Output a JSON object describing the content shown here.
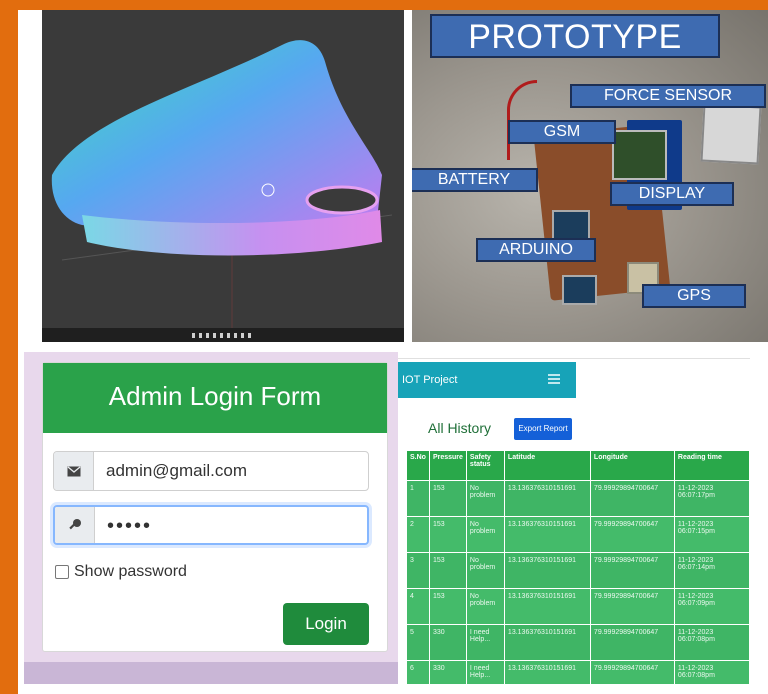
{
  "prototype": {
    "title": "PROTOTYPE",
    "labels": {
      "force_sensor": "FORCE SENSOR",
      "gsm": "GSM",
      "battery": "BATTERY",
      "display": "DISPLAY",
      "arduino": "ARDUINO",
      "gps": "GPS"
    }
  },
  "login": {
    "title": "Admin Login Form",
    "email_value": "admin@gmail.com",
    "password_value": "•••••",
    "show_password_label": "Show password",
    "login_button": "Login",
    "icons": {
      "email": "envelope-icon",
      "password": "key-icon"
    }
  },
  "iot": {
    "nav_title": "IOT Project",
    "section_title": "All History",
    "export_button": "Export Report",
    "columns": [
      "S.No",
      "Pressure",
      "Safety status",
      "Latitude",
      "Longitude",
      "Reading time"
    ],
    "rows": [
      [
        "1",
        "153",
        "No problem",
        "13.136376310151691",
        "79.99929894700647",
        "11-12-2023 06:07:17pm"
      ],
      [
        "2",
        "153",
        "No problem",
        "13.136376310151691",
        "79.99929894700647",
        "11-12-2023 06:07:15pm"
      ],
      [
        "3",
        "153",
        "No problem",
        "13.136376310151691",
        "79.99929894700647",
        "11-12-2023 06:07:14pm"
      ],
      [
        "4",
        "153",
        "No problem",
        "13.136376310151691",
        "79.99929894700647",
        "11-12-2023 06:07:09pm"
      ],
      [
        "5",
        "330",
        "I need Help...",
        "13.136376310151691",
        "79.99929894700647",
        "11-12-2023 06:07:08pm"
      ],
      [
        "6",
        "330",
        "I need Help...",
        "13.136376310151691",
        "79.99929894700647",
        "11-12-2023 06:07:08pm"
      ]
    ]
  },
  "colors": {
    "frame": "#e26d0e",
    "label_blue": "#3e6bb1",
    "login_green": "#2aa24a",
    "table_green": "#3fb565",
    "nav_teal": "#17a3b8",
    "export_blue": "#1460d8"
  }
}
